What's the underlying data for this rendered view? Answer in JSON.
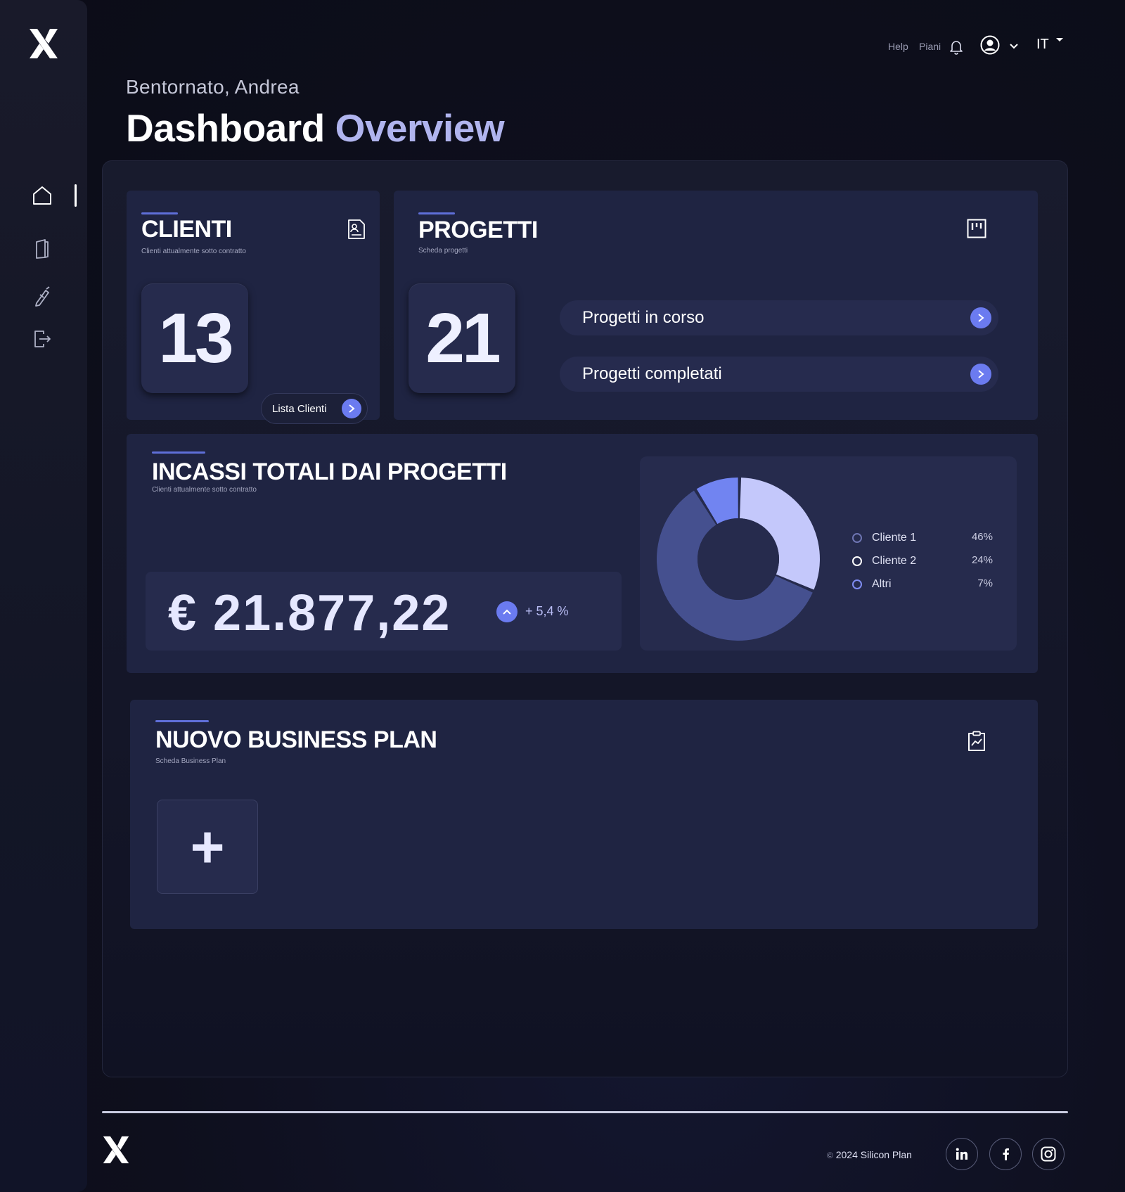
{
  "header": {
    "help_label": "Help",
    "plans_label": "Piani",
    "language": "IT"
  },
  "welcome_text": "Bentornato, Andrea",
  "page_title": {
    "main": "Dashboard",
    "accent": "Overview"
  },
  "clienti": {
    "title": "CLIENTI",
    "subtitle": "Clienti attualmente sotto contratto",
    "count": "13",
    "list_button": "Lista Clienti"
  },
  "progetti": {
    "title": "PROGETTI",
    "subtitle": "Scheda progetti",
    "count": "21",
    "in_progress_label": "Progetti in corso",
    "completed_label": "Progetti completati"
  },
  "incassi": {
    "title": "INCASSI TOTALI DAI PROGETTI",
    "subtitle": "Clienti attualmente sotto contratto",
    "amount": "€ 21.877,22",
    "trend": "+ 5,4 %"
  },
  "chart_data": {
    "type": "pie",
    "donut": true,
    "legend_position": "right",
    "slices": [
      {
        "name": "Cliente 1",
        "value": 46,
        "label": "46%",
        "color": "#45508f"
      },
      {
        "name": "Cliente 2",
        "value": 24,
        "label": "24%",
        "color": "#c4c8fb"
      },
      {
        "name": "Altri",
        "value": 7,
        "label": "7%",
        "color": "#7184f1"
      }
    ]
  },
  "business_plan": {
    "title": "NUOVO BUSINESS PLAN",
    "subtitle": "Scheda Business Plan",
    "add_label": "+"
  },
  "footer": {
    "copyright_symbol": "©",
    "copyright_text": "2024 Silicon Plan",
    "social": [
      "linkedin-icon",
      "facebook-icon",
      "instagram-icon"
    ]
  },
  "colors": {
    "accent": "#6b7bf0",
    "title_accent": "#b0b4ee",
    "card_bg": "#1f2442"
  }
}
